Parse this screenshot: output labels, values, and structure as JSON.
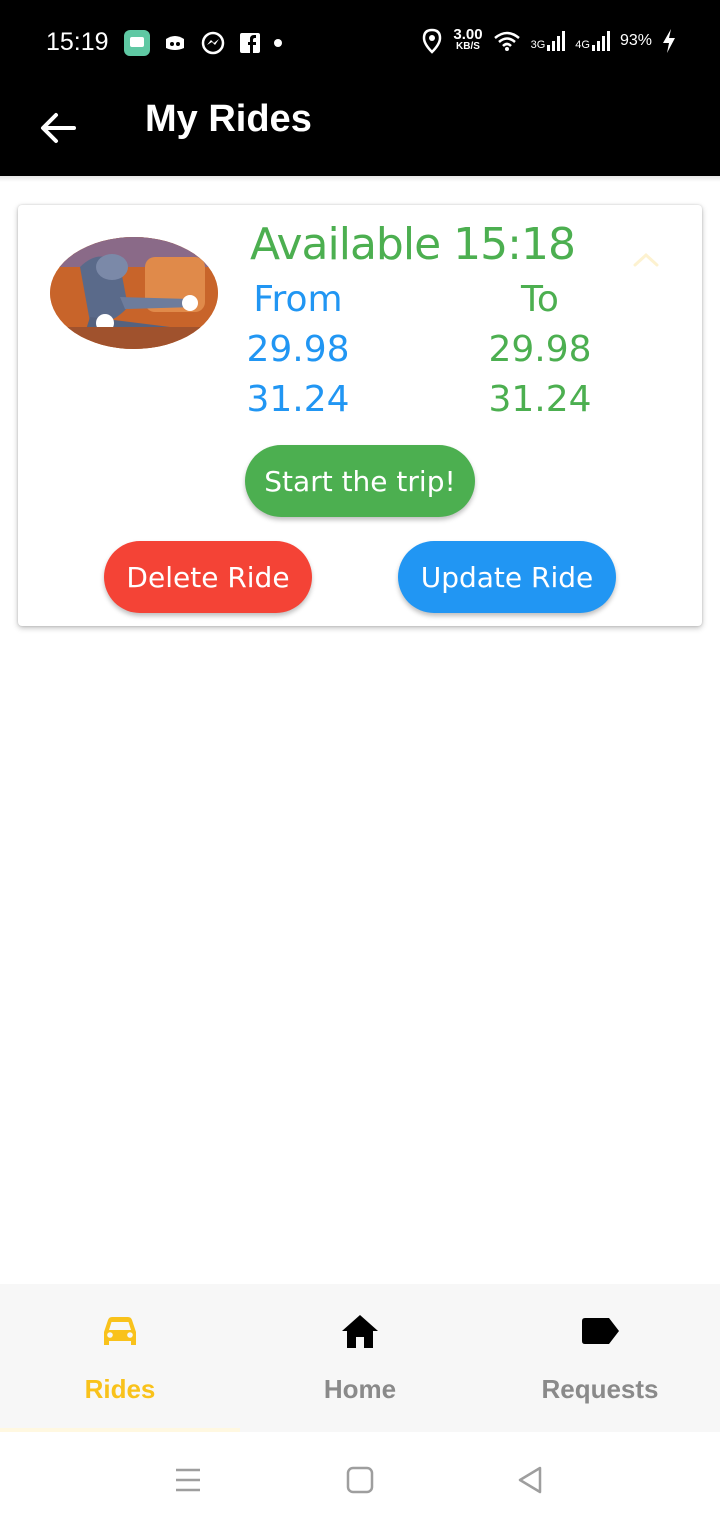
{
  "status_bar": {
    "time": "15:19",
    "speed_value": "3.00",
    "speed_unit": "KB/S",
    "net_3g": "3G",
    "net_4g": "4G",
    "battery": "93%"
  },
  "app_bar": {
    "title": "My Rides",
    "back_icon": "arrow-back-icon"
  },
  "ride_card": {
    "status_text": "Available 15:18",
    "from_label": "From",
    "to_label": "To",
    "from_lat": "29.98",
    "from_lng": "31.24",
    "to_lat": "29.98",
    "to_lng": "31.24",
    "start_button": "Start the trip!",
    "delete_button": "Delete Ride",
    "update_button": "Update Ride"
  },
  "bottom_nav": {
    "items": [
      {
        "label": "Rides",
        "icon": "car-icon",
        "active": true
      },
      {
        "label": "Home",
        "icon": "home-icon",
        "active": false
      },
      {
        "label": "Requests",
        "icon": "label-icon",
        "active": false
      }
    ]
  },
  "colors": {
    "green": "#4caf50",
    "blue": "#2196f3",
    "red": "#f44336",
    "active_nav": "#f9c21b",
    "inactive_nav": "#8a8a8a"
  }
}
